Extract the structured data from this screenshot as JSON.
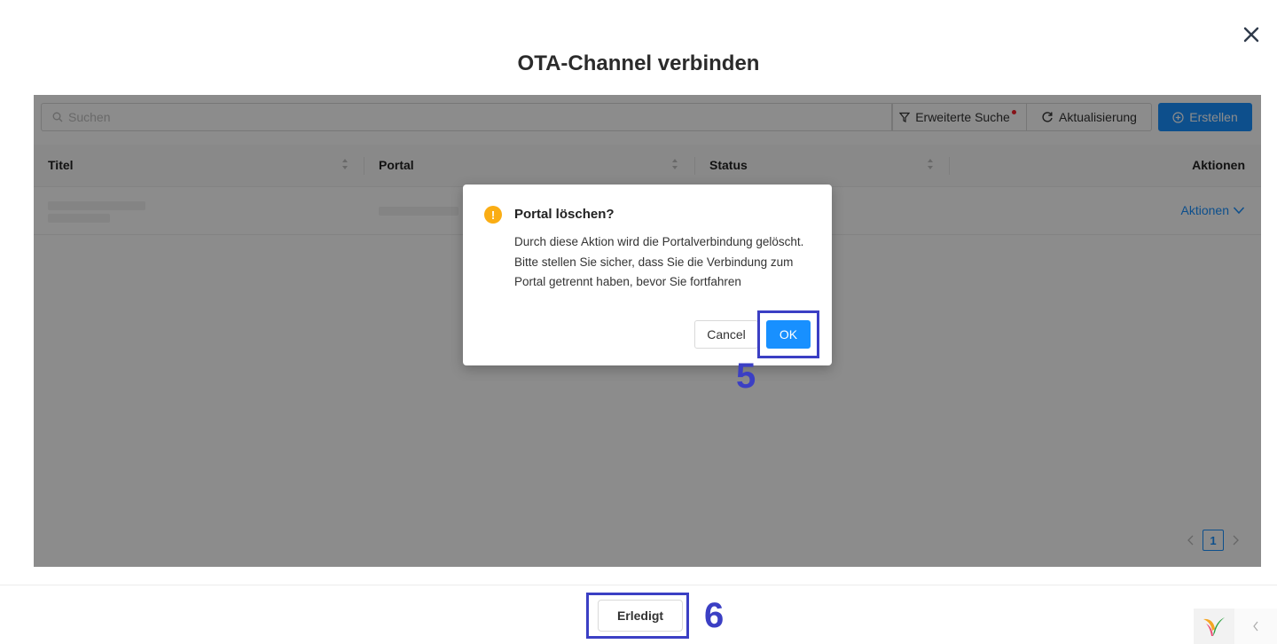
{
  "modal": {
    "title": "OTA-Channel verbinden"
  },
  "toolbar": {
    "search_placeholder": "Suchen",
    "advanced_search_label": "Erweiterte Suche",
    "refresh_label": "Aktualisierung",
    "create_label": "Erstellen"
  },
  "table": {
    "columns": [
      "Titel",
      "Portal",
      "Status",
      "Aktionen"
    ],
    "row_actions_label": "Aktionen"
  },
  "pagination": {
    "current_page": "1"
  },
  "confirm_dialog": {
    "title": "Portal löschen?",
    "body": "Durch diese Aktion wird die Portalverbindung gelöscht. Bitte stellen Sie sicher, dass Sie die Verbindung zum Portal getrennt haben, bevor Sie fortfahren",
    "cancel_label": "Cancel",
    "ok_label": "OK"
  },
  "annotations": {
    "step_ok": "5",
    "step_done": "6"
  },
  "footer": {
    "done_label": "Erledigt"
  },
  "colors": {
    "primary": "#1890ff",
    "warning": "#faad14",
    "annotation": "#3b3fc4"
  }
}
